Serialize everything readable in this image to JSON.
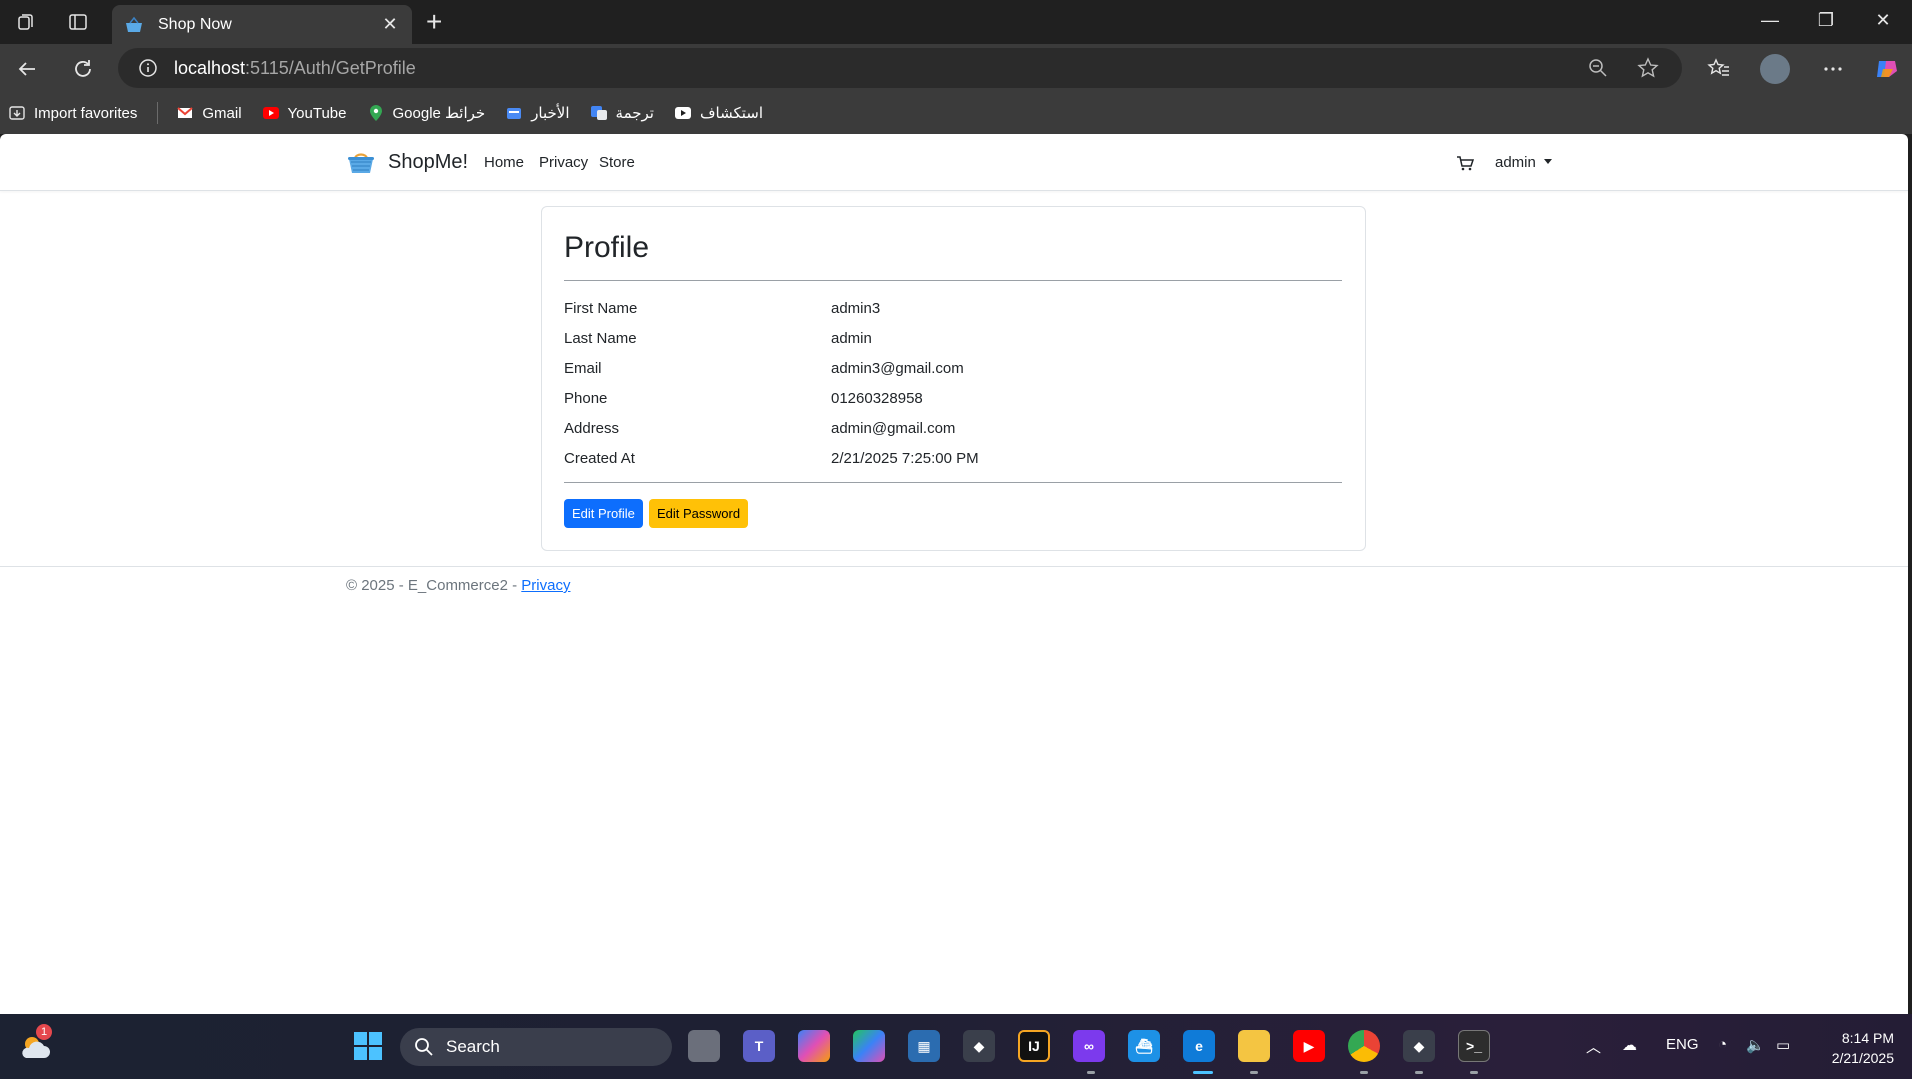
{
  "browser": {
    "tab_title": "Shop Now",
    "url_host": "localhost",
    "url_rest": ":5115/Auth/GetProfile",
    "favorites": [
      {
        "label": "Import favorites",
        "icon": "import-icon"
      },
      {
        "label": "Gmail",
        "icon": "gmail-icon"
      },
      {
        "label": "YouTube",
        "icon": "youtube-icon"
      },
      {
        "label": "Google خرائط",
        "icon": "maps-icon"
      },
      {
        "label": "الأخبار",
        "icon": "news-icon"
      },
      {
        "label": "ترجمة",
        "icon": "translate-icon"
      },
      {
        "label": "استكشاف",
        "icon": "discover-icon"
      }
    ]
  },
  "site": {
    "brand": "ShopMe!",
    "nav": [
      "Home",
      "Privacy",
      "Store"
    ],
    "user": "admin"
  },
  "profile": {
    "title": "Profile",
    "fields": [
      {
        "label": "First Name",
        "value": "admin3"
      },
      {
        "label": "Last Name",
        "value": "admin"
      },
      {
        "label": "Email",
        "value": "admin3@gmail.com"
      },
      {
        "label": "Phone",
        "value": "01260328958"
      },
      {
        "label": "Address",
        "value": "admin@gmail.com"
      },
      {
        "label": "Created At",
        "value": "2/21/2025 7:25:00 PM"
      }
    ],
    "edit_profile_label": "Edit Profile",
    "edit_password_label": "Edit Password"
  },
  "footer": {
    "text": "© 2025 - E_Commerce2 - ",
    "privacy_link": "Privacy"
  },
  "taskbar": {
    "search_label": "Search",
    "weather_badge": "1",
    "language": "ENG",
    "time": "8:14 PM",
    "date": "2/21/2025"
  },
  "colors": {
    "primary": "#0d6efd",
    "warning": "#ffc107"
  }
}
